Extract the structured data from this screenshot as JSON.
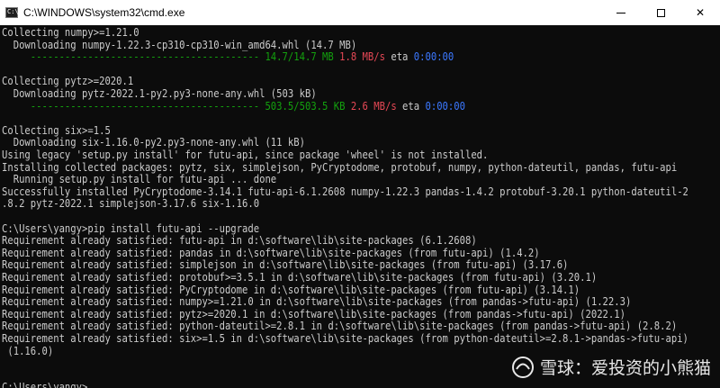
{
  "window": {
    "title": "C:\\WINDOWS\\system32\\cmd.exe",
    "icon_text": "C:\\",
    "controls": {
      "minimize": "minimize-icon",
      "maximize": "maximize-icon",
      "close": "✕"
    }
  },
  "console": {
    "lines": [
      {
        "text": "Collecting numpy>=1.21.0"
      },
      {
        "text": "  Downloading numpy-1.22.3-cp310-cp310-win_amd64.whl (14.7 MB)"
      },
      {
        "parts": [
          {
            "text": "     ",
            "cls": ""
          },
          {
            "text": "----------------------------------------",
            "cls": "green"
          },
          {
            "text": " 14.7/14.7 MB",
            "cls": "green"
          },
          {
            "text": " 1.8 MB/s",
            "cls": "red"
          },
          {
            "text": " eta ",
            "cls": ""
          },
          {
            "text": "0:00:00",
            "cls": "blue"
          }
        ]
      },
      {
        "text": ""
      },
      {
        "text": "Collecting pytz>=2020.1"
      },
      {
        "text": "  Downloading pytz-2022.1-py2.py3-none-any.whl (503 kB)"
      },
      {
        "parts": [
          {
            "text": "     ",
            "cls": ""
          },
          {
            "text": "----------------------------------------",
            "cls": "green"
          },
          {
            "text": " 503.5/503.5 KB",
            "cls": "green"
          },
          {
            "text": " 2.6 MB/s",
            "cls": "red"
          },
          {
            "text": " eta ",
            "cls": ""
          },
          {
            "text": "0:00:00",
            "cls": "blue"
          }
        ]
      },
      {
        "text": ""
      },
      {
        "text": "Collecting six>=1.5"
      },
      {
        "text": "  Downloading six-1.16.0-py2.py3-none-any.whl (11 kB)"
      },
      {
        "text": "Using legacy 'setup.py install' for futu-api, since package 'wheel' is not installed."
      },
      {
        "text": "Installing collected packages: pytz, six, simplejson, PyCryptodome, protobuf, numpy, python-dateutil, pandas, futu-api"
      },
      {
        "text": "  Running setup.py install for futu-api ... done"
      },
      {
        "text": "Successfully installed PyCryptodome-3.14.1 futu-api-6.1.2608 numpy-1.22.3 pandas-1.4.2 protobuf-3.20.1 python-dateutil-2"
      },
      {
        "text": ".8.2 pytz-2022.1 simplejson-3.17.6 six-1.16.0"
      },
      {
        "text": ""
      },
      {
        "text": "C:\\Users\\yangy>pip install futu-api --upgrade"
      },
      {
        "text": "Requirement already satisfied: futu-api in d:\\software\\lib\\site-packages (6.1.2608)"
      },
      {
        "text": "Requirement already satisfied: pandas in d:\\software\\lib\\site-packages (from futu-api) (1.4.2)"
      },
      {
        "text": "Requirement already satisfied: simplejson in d:\\software\\lib\\site-packages (from futu-api) (3.17.6)"
      },
      {
        "text": "Requirement already satisfied: protobuf>=3.5.1 in d:\\software\\lib\\site-packages (from futu-api) (3.20.1)"
      },
      {
        "text": "Requirement already satisfied: PyCryptodome in d:\\software\\lib\\site-packages (from futu-api) (3.14.1)"
      },
      {
        "text": "Requirement already satisfied: numpy>=1.21.0 in d:\\software\\lib\\site-packages (from pandas->futu-api) (1.22.3)"
      },
      {
        "text": "Requirement already satisfied: pytz>=2020.1 in d:\\software\\lib\\site-packages (from pandas->futu-api) (2022.1)"
      },
      {
        "text": "Requirement already satisfied: python-dateutil>=2.8.1 in d:\\software\\lib\\site-packages (from pandas->futu-api) (2.8.2)"
      },
      {
        "text": "Requirement already satisfied: six>=1.5 in d:\\software\\lib\\site-packages (from python-dateutil>=2.8.1->pandas->futu-api)"
      },
      {
        "text": " (1.16.0)"
      },
      {
        "text": ""
      },
      {
        "text": ""
      },
      {
        "text": "C:\\Users\\yangy>",
        "cursor": true
      }
    ]
  },
  "watermark": {
    "text": "雪球：爱投资的小熊猫",
    "icon": "snowball-logo-icon"
  },
  "colors": {
    "background": "#0c0c0c",
    "text": "#cccccc",
    "green": "#13a10e",
    "red": "#e74856",
    "blue": "#3b78ff"
  }
}
